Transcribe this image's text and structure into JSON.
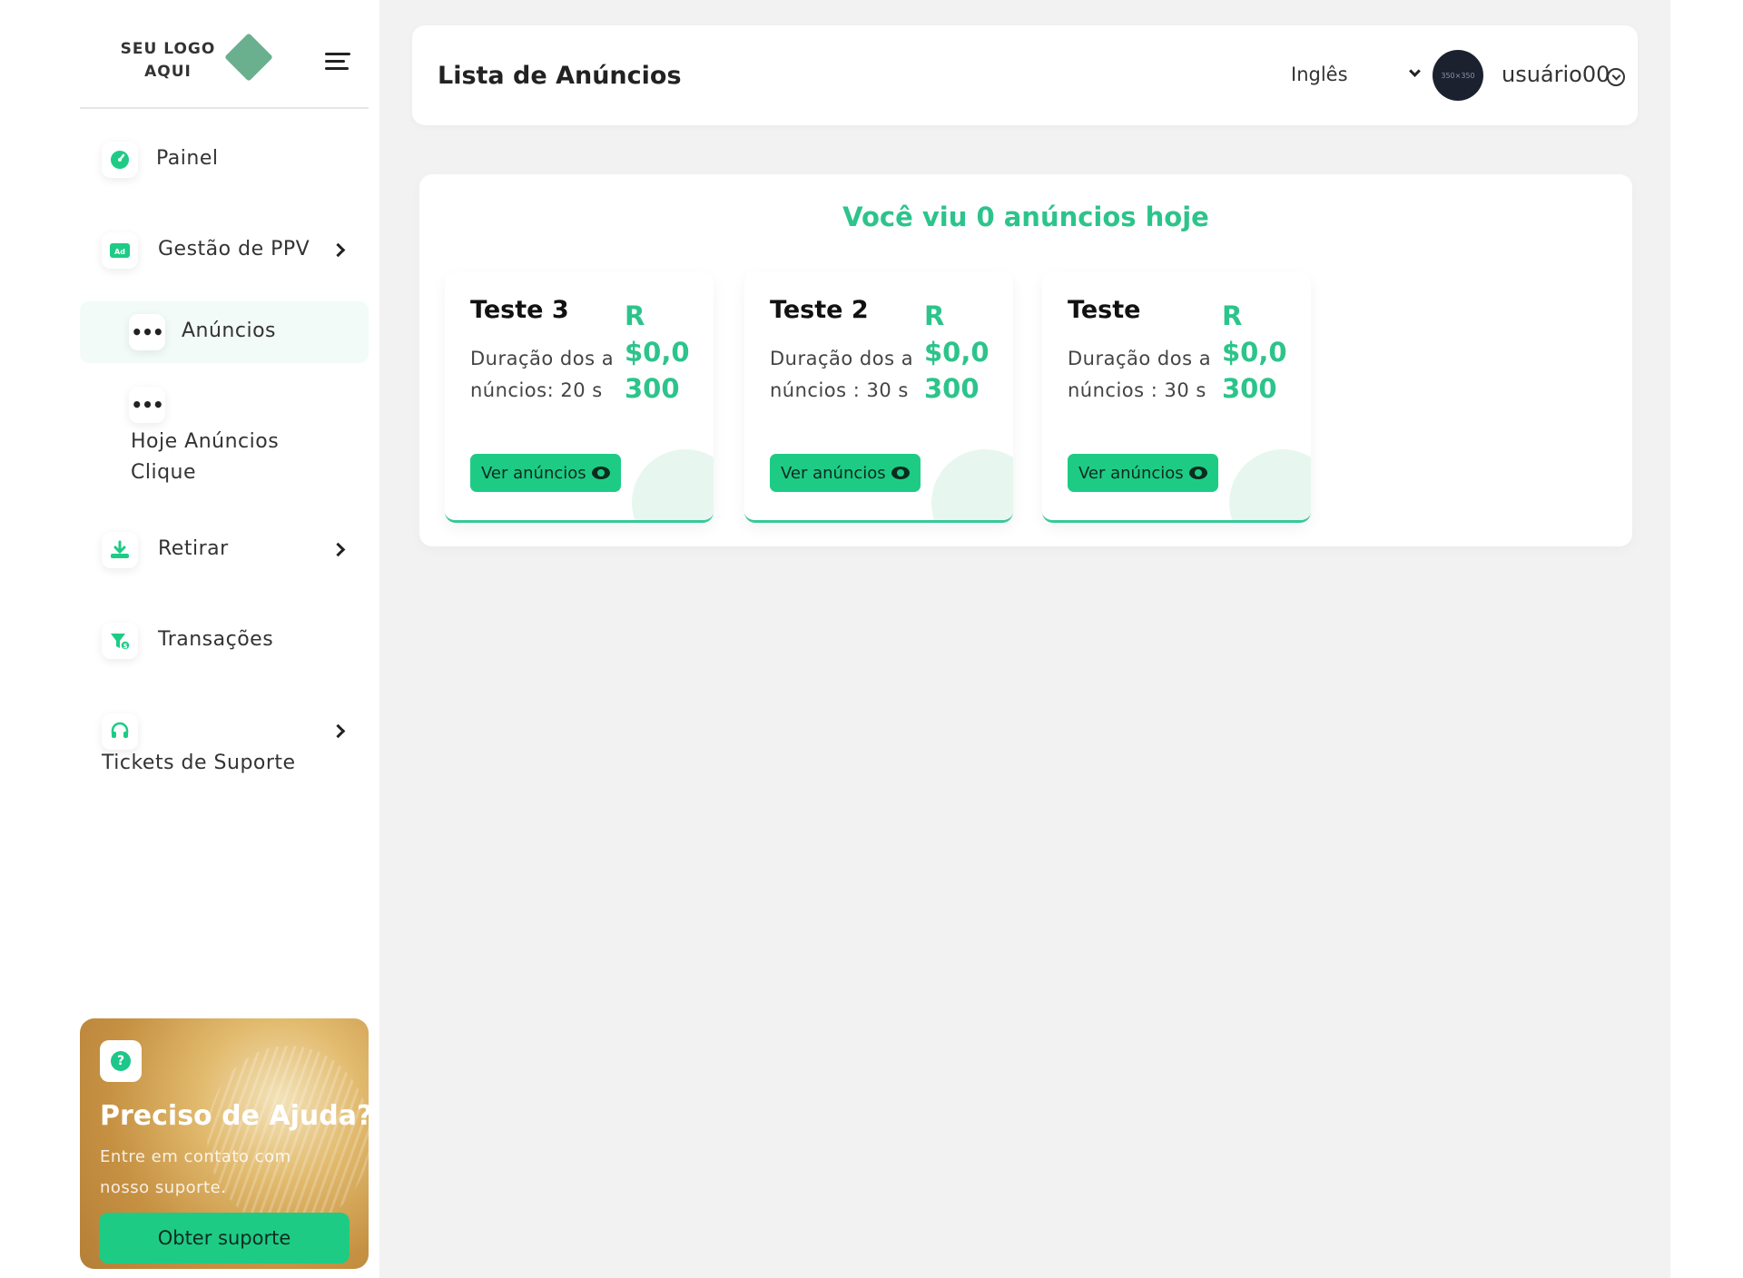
{
  "brand": {
    "logo_text_line1": "SEU LOGO",
    "logo_text_line2": "AQUI",
    "accent_color": "#1ecb85"
  },
  "sidebar": {
    "items": [
      {
        "label": "Painel",
        "icon": "dashboard-icon"
      },
      {
        "label": "Gestão de PPV",
        "icon": "ad-icon"
      },
      {
        "label": "Anúncios",
        "icon": "more-dots-icon"
      },
      {
        "label": "Hoje Anúncios Clique",
        "icon": "more-dots-icon"
      },
      {
        "label": "Retirar",
        "icon": "withdraw-icon"
      },
      {
        "label": "Transações",
        "icon": "transactions-icon"
      },
      {
        "label": "Tickets de Suporte",
        "icon": "headset-icon"
      }
    ],
    "help": {
      "title": "Preciso de Ajuda?",
      "subtitle": "Entre em contato com nosso suporte.",
      "button": "Obter suporte"
    }
  },
  "header": {
    "title": "Lista de Anúncios",
    "language": "Inglês",
    "avatar_text": "350×350",
    "username": "usuário00"
  },
  "main": {
    "viewed_text": "Você viu 0 anúncios hoje",
    "ads": [
      {
        "name": "Teste 3",
        "duration": "Duração dos anúncios: 20 s",
        "price": "R$0,0300",
        "button": "Ver anúncios"
      },
      {
        "name": "Teste 2",
        "duration": "Duração dos anúncios : 30 s",
        "price": "R$0,0300",
        "button": "Ver anúncios"
      },
      {
        "name": "Teste",
        "duration": "Duração dos anúncios : 30 s",
        "price": "R$0,0300",
        "button": "Ver anúncios"
      }
    ]
  }
}
